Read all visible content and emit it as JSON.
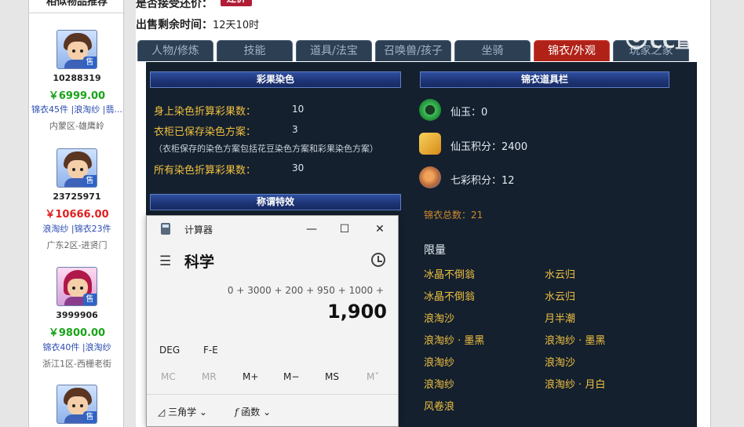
{
  "sidebar": {
    "title": "相似物品推荐",
    "products": [
      {
        "id": "10288319",
        "price": "￥6999.00",
        "price_color": "#1aa31a",
        "tags": "锦衣45件 |浪淘纱 |翡...",
        "server": "内蒙区-雄鹰岭",
        "badge": "售"
      },
      {
        "id": "23725971",
        "price": "￥10666.00",
        "price_color": "#e02020",
        "tags": "浪淘纱 |锦衣23件",
        "server": "广东2区-进贤门",
        "badge": "售"
      },
      {
        "id": "3999906",
        "price": "￥9800.00",
        "price_color": "#1aa31a",
        "tags": "锦衣40件 |浪淘纱",
        "server": "浙江1区-西栅老街",
        "badge": "售"
      },
      {
        "badge": "售"
      }
    ]
  },
  "info": {
    "bargain_label": "是否接受还价：",
    "bargain_button": "还价",
    "time_label": "出售剩余时间：",
    "time_value": "12天10时"
  },
  "tabs": [
    "人物/修炼",
    "技能",
    "道具/法宝",
    "召唤兽/孩子",
    "坐骑",
    "锦衣/外观",
    "玩家之家"
  ],
  "active_tab": "锦衣/外观",
  "dye": {
    "header": "彩果染色",
    "row1_label": "身上染色折算彩果数：",
    "row1_value": "10",
    "row2_label": "衣柜已保存染色方案：",
    "row2_value": "3",
    "note": "（衣柜保存的染色方案包括花豆染色方案和彩果染色方案）",
    "row3_label": "所有染色折算彩果数：",
    "row3_value": "30"
  },
  "title_effect": {
    "header": "称谓特效"
  },
  "wardrobe": {
    "header": "锦衣道具栏",
    "xianyu": "仙玉：0",
    "xianyu_points": "仙玉积分：2400",
    "qicai_points": "七彩积分：12",
    "total": "锦衣总数：21",
    "limited_title": "限量",
    "limited_left": [
      "冰晶不倒翁",
      "冰晶不倒翁",
      "浪淘沙",
      "浪淘纱 · 墨黑",
      "浪淘纱",
      "浪淘纱",
      "风卷浪"
    ],
    "limited_right": [
      "水云归",
      "水云归",
      "月半潮",
      "浪淘纱 · 墨黑",
      "浪淘沙",
      "浪淘纱 · 月白"
    ]
  },
  "calculator": {
    "title": "计算器",
    "mode": "科学",
    "expression": "0 + 3000 + 200 + 950 + 1000 +",
    "result": "1,900",
    "deg": "DEG",
    "fe": "F-E",
    "memory": [
      "MC",
      "MR",
      "M+",
      "M−",
      "MS",
      "M˅"
    ],
    "trig": "三角学",
    "func": "函数"
  },
  "watermark": "CC直播"
}
